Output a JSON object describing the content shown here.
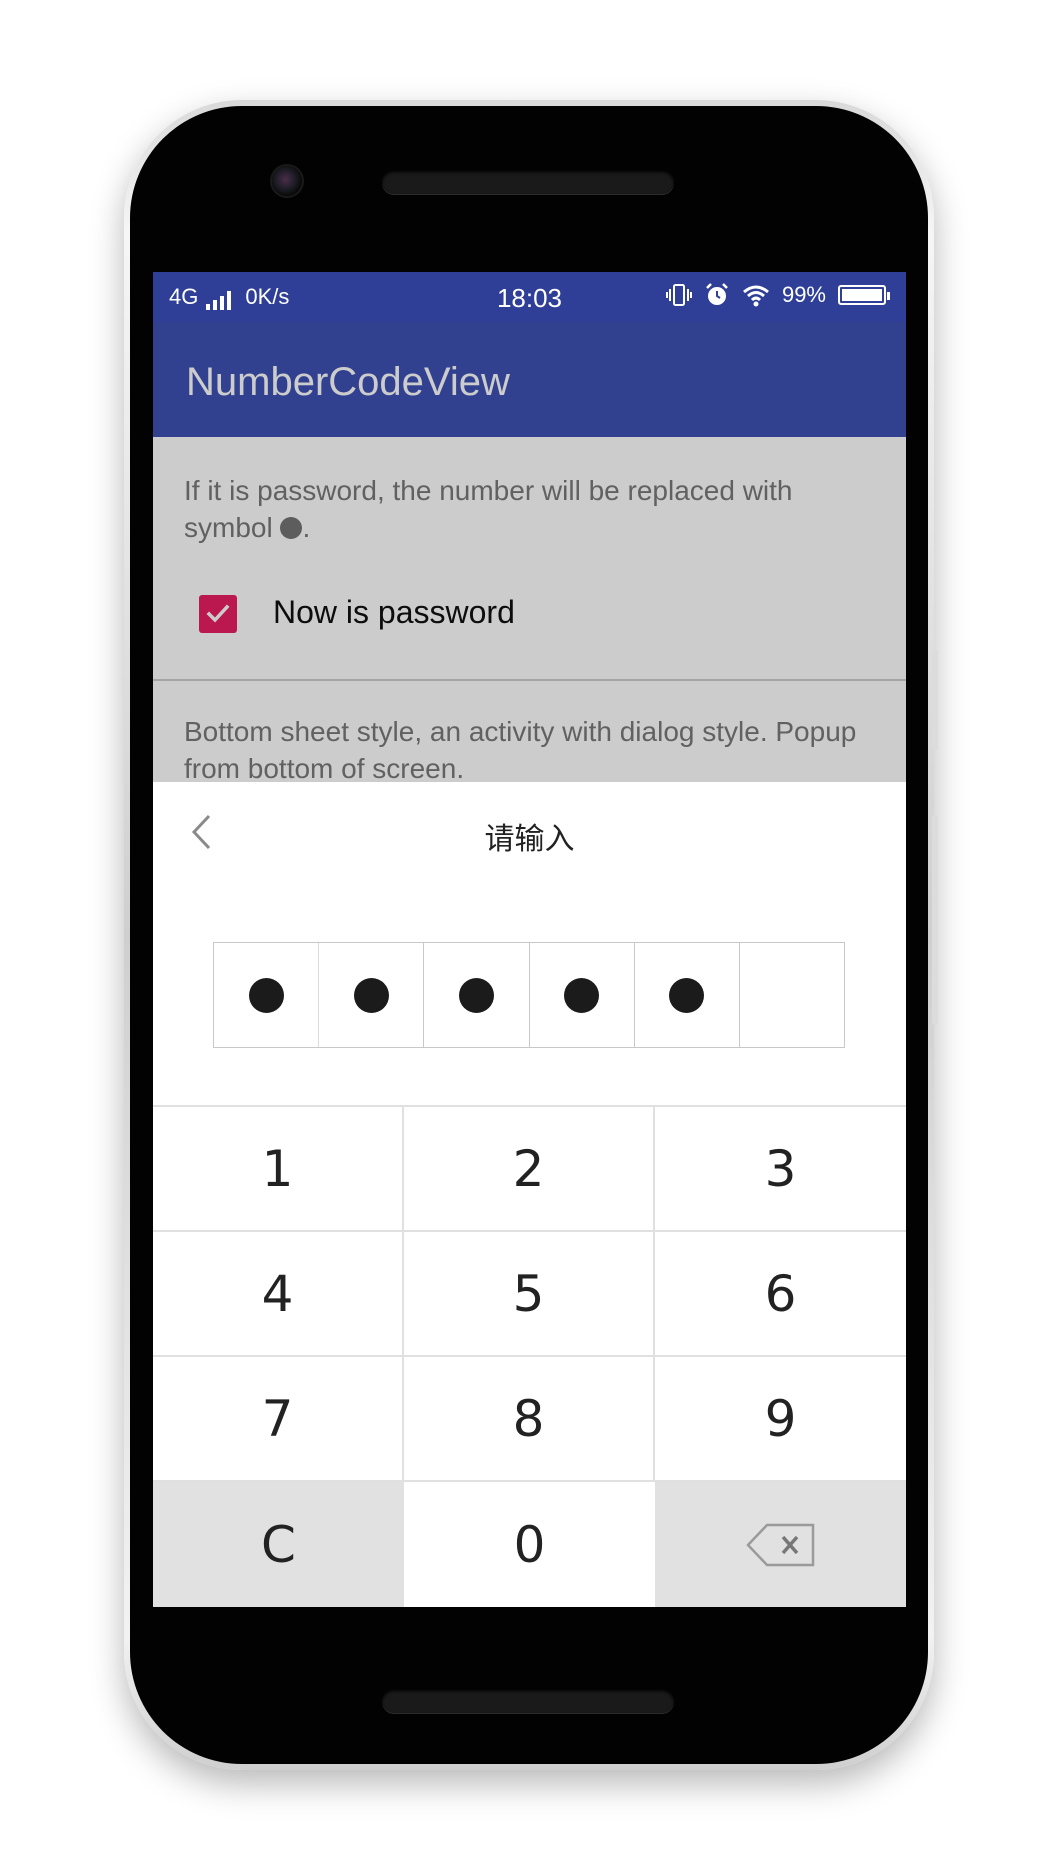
{
  "status_bar": {
    "network": "4G",
    "speed": "0K/s",
    "time": "18:03",
    "battery": "99%"
  },
  "app_bar": {
    "title": "NumberCodeView"
  },
  "content": {
    "password_description": "If it is password, the number will be replaced with symbol",
    "password_description_end": ".",
    "password_checkbox": {
      "label": "Now is password",
      "checked": true
    },
    "sheet_description": "Bottom sheet style, an activity with dialog style. Popup from bottom of screen."
  },
  "sheet": {
    "title": "请输入",
    "code": {
      "length": 6,
      "filled": 5
    }
  },
  "keypad": {
    "keys": [
      "1",
      "2",
      "3",
      "4",
      "5",
      "6",
      "7",
      "8",
      "9",
      "C",
      "0"
    ]
  },
  "colors": {
    "primary": "#3f51b5",
    "status_bar": "#2f3f97",
    "accent": "#e91e63"
  }
}
